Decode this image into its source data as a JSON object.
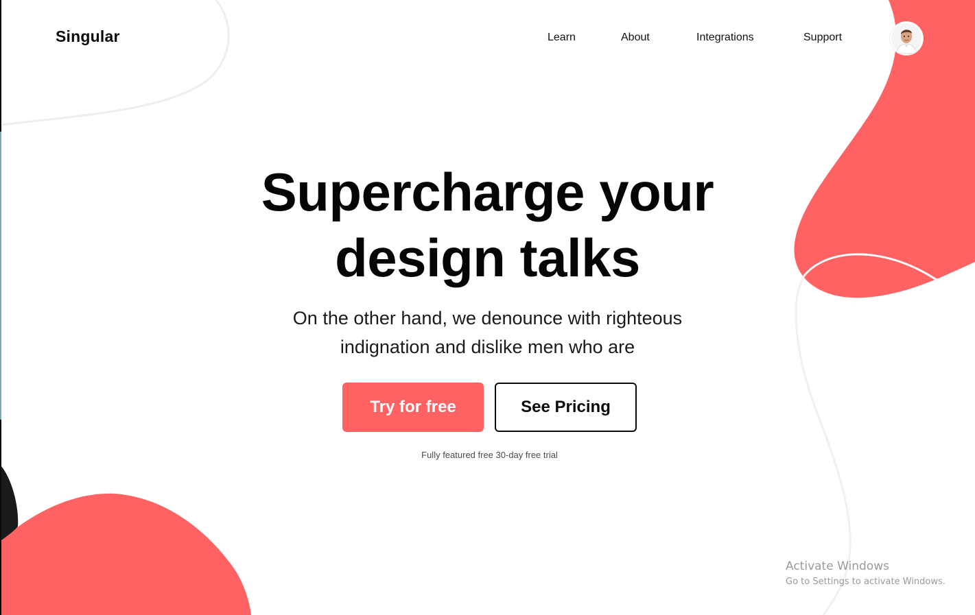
{
  "brand": {
    "name": "Singular",
    "accent_color": "#ff6262"
  },
  "nav": {
    "items": [
      {
        "label": "Learn"
      },
      {
        "label": "About"
      },
      {
        "label": "Integrations"
      },
      {
        "label": "Support"
      }
    ],
    "avatar_icon": "user-avatar"
  },
  "hero": {
    "title_line_1": "Supercharge your",
    "title_line_2": "design talks",
    "subtitle_line_1": "On the other hand, we denounce with righteous",
    "subtitle_line_2": "indignation and dislike men who are",
    "primary_cta": "Try for free",
    "secondary_cta": "See Pricing",
    "trial_note": "Fully featured free 30-day free trial"
  },
  "os_watermark": {
    "title": "Activate Windows",
    "subtitle": "Go to Settings to activate Windows."
  }
}
